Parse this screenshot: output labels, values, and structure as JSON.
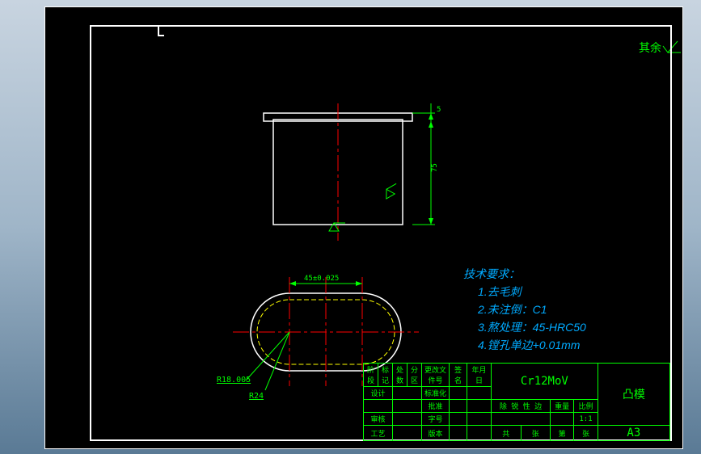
{
  "domain": "CAD Engineering Drawing",
  "surface_symbols": {
    "top_right": "其余",
    "checkmark": "✓"
  },
  "top_view": {
    "dim_height": "75",
    "dim_flange": "5",
    "surface_mark_bottom": "△",
    "surface_mark_side": "△"
  },
  "plan_view": {
    "dim_width_label": "45±0.025",
    "radius1_label": "R18.005",
    "radius2_label": "R24"
  },
  "tech_requirements": {
    "title": "技术要求：",
    "items": [
      "1.去毛刺",
      "2.未注倒：C1",
      "3.熬处理：45-HRC50",
      "4.镗孔单边+0.01mm"
    ]
  },
  "title_block": {
    "material": "Cr12MoV",
    "part_name": "凸模",
    "sheet_size": "A3",
    "scale_label": "比例",
    "scale_value": "1:1",
    "stage_cols": [
      "阶段",
      "标记",
      "处数",
      "分区",
      "更改文件号",
      "签名",
      "年月日"
    ],
    "rows": {
      "design": "设计",
      "check": "审核",
      "process": "工艺",
      "std": "标准化",
      "approve": "批准",
      "weight": "重量"
    },
    "footer_cols": [
      "共",
      "张",
      "第",
      "张"
    ],
    "note": "除 锐 性 边"
  }
}
